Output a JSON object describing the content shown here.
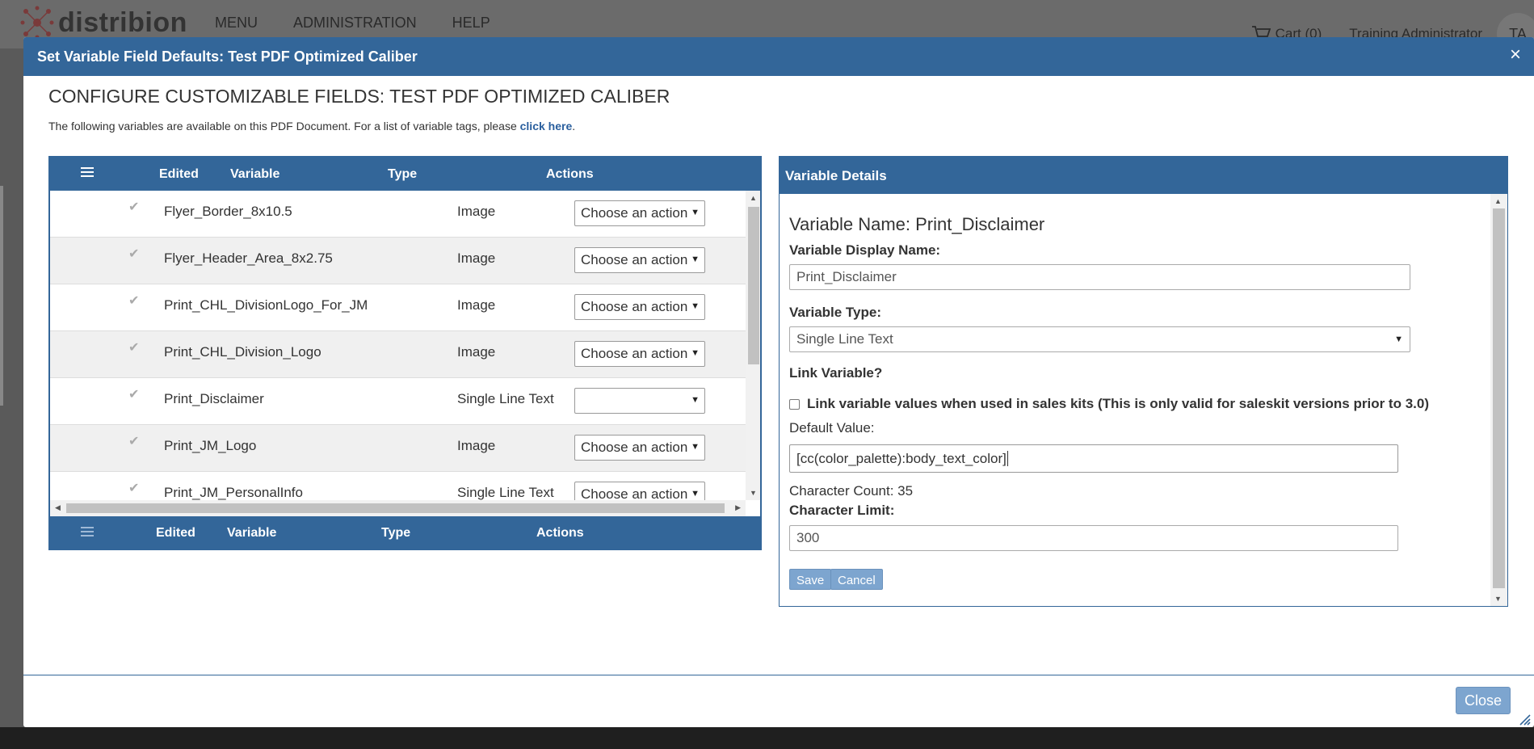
{
  "app": {
    "logo_text": "distribion",
    "nav": [
      "MENU",
      "ADMINISTRATION",
      "HELP"
    ],
    "cart_label": "Cart (0)",
    "user_name": "Training Administrator",
    "user_initials": "TA"
  },
  "modal": {
    "title": "Set Variable Field Defaults: Test PDF Optimized Caliber",
    "section_title": "CONFIGURE CUSTOMIZABLE FIELDS: TEST PDF OPTIMIZED CALIBER",
    "intro_text": "The following variables are available on this PDF Document. For a list of variable tags, please ",
    "intro_link": "click here",
    "intro_end": ".",
    "close_label": "Close"
  },
  "grid": {
    "columns": [
      "Edited",
      "Variable",
      "Type",
      "Actions"
    ],
    "rows": [
      {
        "variable": "Flyer_Border_8x10.5",
        "type": "Image",
        "action": "Choose an action"
      },
      {
        "variable": "Flyer_Header_Area_8x2.75",
        "type": "Image",
        "action": "Choose an action"
      },
      {
        "variable": "Print_CHL_DivisionLogo_For_JM",
        "type": "Image",
        "action": "Choose an action"
      },
      {
        "variable": "Print_CHL_Division_Logo",
        "type": "Image",
        "action": "Choose an action"
      },
      {
        "variable": "Print_Disclaimer",
        "type": "Single Line Text",
        "action": ""
      },
      {
        "variable": "Print_JM_Logo",
        "type": "Image",
        "action": "Choose an action"
      },
      {
        "variable": "Print_JM_PersonalInfo",
        "type": "Single Line Text",
        "action": "Choose an action"
      }
    ]
  },
  "details": {
    "header": "Variable Details",
    "variable_name_line": "Variable Name: Print_Disclaimer",
    "display_name_label": "Variable Display Name:",
    "display_name_placeholder": "Print_Disclaimer",
    "type_label": "Variable Type:",
    "type_value": "Single Line Text",
    "link_label": "Link Variable?",
    "link_checkbox_label": "Link variable values when used in sales kits (This is only valid for saleskit versions prior to 3.0)",
    "default_label": "Default Value:",
    "default_value": "[cc(color_palette):body_text_color]",
    "char_count": "Character Count: 35",
    "char_limit_label": "Character Limit:",
    "char_limit_value": "300",
    "save_label": "Save",
    "cancel_label": "Cancel"
  },
  "colors": {
    "header_blue": "#336699",
    "button_blue": "#7da5cf",
    "link_blue": "#2a5f9e"
  }
}
